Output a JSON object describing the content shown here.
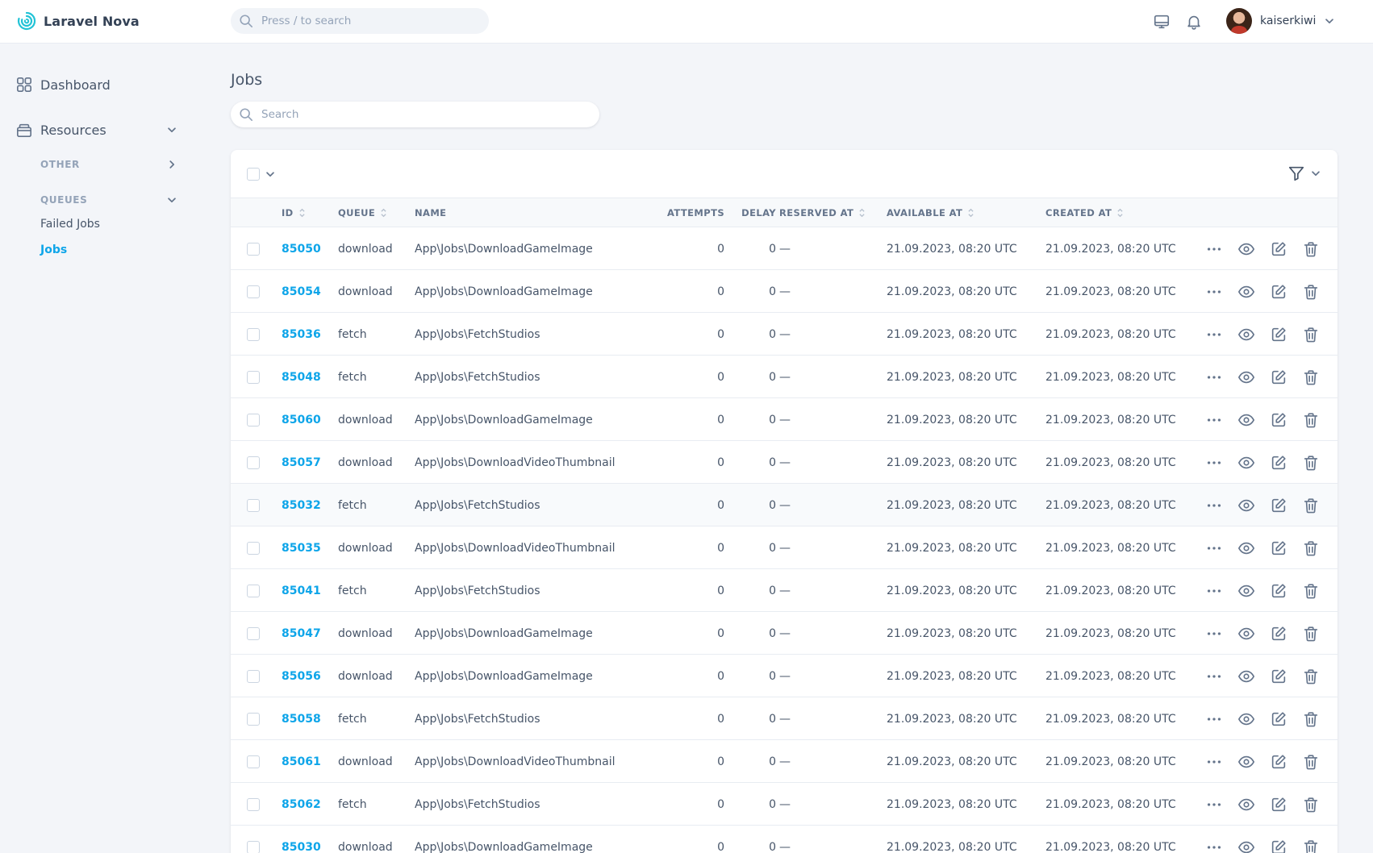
{
  "app": {
    "name": "Laravel Nova",
    "search_placeholder": "Press / to search",
    "user_name": "kaiserkiwi",
    "accent_color": "#0ea5e9"
  },
  "sidebar": {
    "dashboard_label": "Dashboard",
    "resources_label": "Resources",
    "other_label": "OTHER",
    "queues_label": "QUEUES",
    "failed_jobs_label": "Failed Jobs",
    "jobs_label": "Jobs"
  },
  "page": {
    "title": "Jobs",
    "search_placeholder": "Search"
  },
  "table": {
    "columns": {
      "id": "ID",
      "queue": "QUEUE",
      "name": "NAME",
      "attempts": "ATTEMPTS",
      "delay": "DELAY",
      "reserved_at": "RESERVED AT",
      "available_at": "AVAILABLE AT",
      "created_at": "CREATED AT"
    },
    "rows": [
      {
        "id": "85050",
        "queue": "download",
        "name": "App\\Jobs\\DownloadGameImage",
        "attempts": "0",
        "delay": "0",
        "reserved_at": "—",
        "available_at": "21.09.2023, 08:20 UTC",
        "created_at": "21.09.2023, 08:20 UTC"
      },
      {
        "id": "85054",
        "queue": "download",
        "name": "App\\Jobs\\DownloadGameImage",
        "attempts": "0",
        "delay": "0",
        "reserved_at": "—",
        "available_at": "21.09.2023, 08:20 UTC",
        "created_at": "21.09.2023, 08:20 UTC"
      },
      {
        "id": "85036",
        "queue": "fetch",
        "name": "App\\Jobs\\FetchStudios",
        "attempts": "0",
        "delay": "0",
        "reserved_at": "—",
        "available_at": "21.09.2023, 08:20 UTC",
        "created_at": "21.09.2023, 08:20 UTC"
      },
      {
        "id": "85048",
        "queue": "fetch",
        "name": "App\\Jobs\\FetchStudios",
        "attempts": "0",
        "delay": "0",
        "reserved_at": "—",
        "available_at": "21.09.2023, 08:20 UTC",
        "created_at": "21.09.2023, 08:20 UTC"
      },
      {
        "id": "85060",
        "queue": "download",
        "name": "App\\Jobs\\DownloadGameImage",
        "attempts": "0",
        "delay": "0",
        "reserved_at": "—",
        "available_at": "21.09.2023, 08:20 UTC",
        "created_at": "21.09.2023, 08:20 UTC"
      },
      {
        "id": "85057",
        "queue": "download",
        "name": "App\\Jobs\\DownloadVideoThumbnail",
        "attempts": "0",
        "delay": "0",
        "reserved_at": "—",
        "available_at": "21.09.2023, 08:20 UTC",
        "created_at": "21.09.2023, 08:20 UTC"
      },
      {
        "id": "85032",
        "queue": "fetch",
        "name": "App\\Jobs\\FetchStudios",
        "attempts": "0",
        "delay": "0",
        "reserved_at": "—",
        "available_at": "21.09.2023, 08:20 UTC",
        "created_at": "21.09.2023, 08:20 UTC"
      },
      {
        "id": "85035",
        "queue": "download",
        "name": "App\\Jobs\\DownloadVideoThumbnail",
        "attempts": "0",
        "delay": "0",
        "reserved_at": "—",
        "available_at": "21.09.2023, 08:20 UTC",
        "created_at": "21.09.2023, 08:20 UTC"
      },
      {
        "id": "85041",
        "queue": "fetch",
        "name": "App\\Jobs\\FetchStudios",
        "attempts": "0",
        "delay": "0",
        "reserved_at": "—",
        "available_at": "21.09.2023, 08:20 UTC",
        "created_at": "21.09.2023, 08:20 UTC"
      },
      {
        "id": "85047",
        "queue": "download",
        "name": "App\\Jobs\\DownloadGameImage",
        "attempts": "0",
        "delay": "0",
        "reserved_at": "—",
        "available_at": "21.09.2023, 08:20 UTC",
        "created_at": "21.09.2023, 08:20 UTC"
      },
      {
        "id": "85056",
        "queue": "download",
        "name": "App\\Jobs\\DownloadGameImage",
        "attempts": "0",
        "delay": "0",
        "reserved_at": "—",
        "available_at": "21.09.2023, 08:20 UTC",
        "created_at": "21.09.2023, 08:20 UTC"
      },
      {
        "id": "85058",
        "queue": "fetch",
        "name": "App\\Jobs\\FetchStudios",
        "attempts": "0",
        "delay": "0",
        "reserved_at": "—",
        "available_at": "21.09.2023, 08:20 UTC",
        "created_at": "21.09.2023, 08:20 UTC"
      },
      {
        "id": "85061",
        "queue": "download",
        "name": "App\\Jobs\\DownloadVideoThumbnail",
        "attempts": "0",
        "delay": "0",
        "reserved_at": "—",
        "available_at": "21.09.2023, 08:20 UTC",
        "created_at": "21.09.2023, 08:20 UTC"
      },
      {
        "id": "85062",
        "queue": "fetch",
        "name": "App\\Jobs\\FetchStudios",
        "attempts": "0",
        "delay": "0",
        "reserved_at": "—",
        "available_at": "21.09.2023, 08:20 UTC",
        "created_at": "21.09.2023, 08:20 UTC"
      },
      {
        "id": "85030",
        "queue": "download",
        "name": "App\\Jobs\\DownloadGameImage",
        "attempts": "0",
        "delay": "0",
        "reserved_at": "—",
        "available_at": "21.09.2023, 08:20 UTC",
        "created_at": "21.09.2023, 08:20 UTC"
      }
    ]
  },
  "icons": {
    "logo": "nova-spiral-icon",
    "search": "search-icon",
    "monitor": "monitor-icon",
    "bell": "bell-icon",
    "filter": "filter-icon",
    "more": "more-icon",
    "view": "eye-icon",
    "edit": "edit-icon",
    "delete": "trash-icon"
  }
}
